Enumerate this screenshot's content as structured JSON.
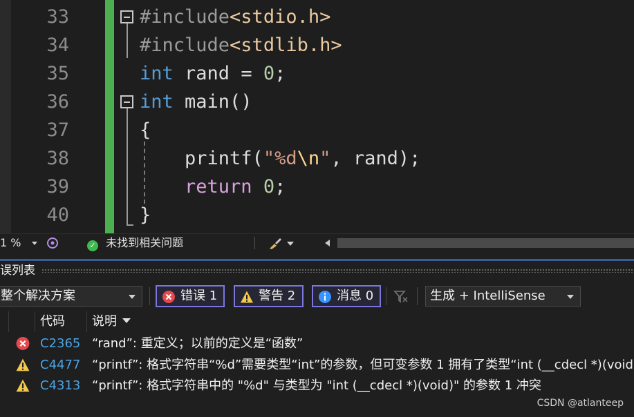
{
  "editor": {
    "lines": [
      {
        "num": "33",
        "fold": true,
        "tokens": [
          {
            "c": "tok-pre",
            "t": "#include"
          },
          {
            "c": "tok-inc",
            "t": "<stdio.h>"
          }
        ]
      },
      {
        "num": "34",
        "fold": false,
        "tokens": [
          {
            "c": "tok-pre",
            "t": "#include"
          },
          {
            "c": "tok-inc",
            "t": "<stdlib.h>"
          }
        ]
      },
      {
        "num": "35",
        "fold": false,
        "tokens": [
          {
            "c": "tok-kw",
            "t": "int"
          },
          {
            "c": "tok-var",
            "t": " rand = "
          },
          {
            "c": "tok-num",
            "t": "0"
          },
          {
            "c": "tok-var",
            "t": ";"
          }
        ]
      },
      {
        "num": "36",
        "fold": true,
        "tokens": [
          {
            "c": "tok-kw",
            "t": "int"
          },
          {
            "c": "tok-var",
            "t": " main()"
          }
        ]
      },
      {
        "num": "37",
        "fold": false,
        "tokens": [
          {
            "c": "tok-var",
            "t": "{"
          }
        ]
      },
      {
        "num": "38",
        "fold": false,
        "tokens": [
          {
            "c": "tok-var",
            "t": "    printf("
          },
          {
            "c": "tok-str",
            "t": "\"%d"
          },
          {
            "c": "tok-esc",
            "t": "\\n"
          },
          {
            "c": "tok-str",
            "t": "\""
          },
          {
            "c": "tok-var",
            "t": ", rand);"
          }
        ]
      },
      {
        "num": "39",
        "fold": false,
        "tokens": [
          {
            "c": "tok-var",
            "t": "    "
          },
          {
            "c": "tok-ctl",
            "t": "return"
          },
          {
            "c": "tok-var",
            "t": " "
          },
          {
            "c": "tok-num",
            "t": "0"
          },
          {
            "c": "tok-var",
            "t": ";"
          }
        ]
      },
      {
        "num": "40",
        "fold": false,
        "tokens": [
          {
            "c": "tok-var",
            "t": "}"
          }
        ]
      }
    ]
  },
  "status_bar": {
    "zoom": "1 %",
    "issues_text": "未找到相关问题"
  },
  "error_list": {
    "title": "误列表",
    "scope": "整个解决方案",
    "errors_label": "错误 1",
    "warnings_label": "警告 2",
    "messages_label": "消息 0",
    "source_filter": "生成 + IntelliSense",
    "columns": {
      "code": "代码",
      "description": "说明"
    },
    "rows": [
      {
        "severity": "error",
        "code": "C2365",
        "description": "“rand”: 重定义；以前的定义是“函数”"
      },
      {
        "severity": "warning",
        "code": "C4477",
        "description": "“printf”: 格式字符串“%d”需要类型“int”的参数，但可变参数 1 拥有了类型“int (__cdecl *)(void)”"
      },
      {
        "severity": "warning",
        "code": "C4313",
        "description": "“printf”: 格式字符串中的 \"%d\" 与类型为 \"int (__cdecl *)(void)\" 的参数 1 冲突"
      }
    ]
  },
  "watermark": "CSDN @atlanteep",
  "colors": {
    "accent": "#7b76e0",
    "error": "#e5484d",
    "warning": "#f2c94c",
    "info": "#3794ff",
    "change_bar": "#4caf50"
  }
}
